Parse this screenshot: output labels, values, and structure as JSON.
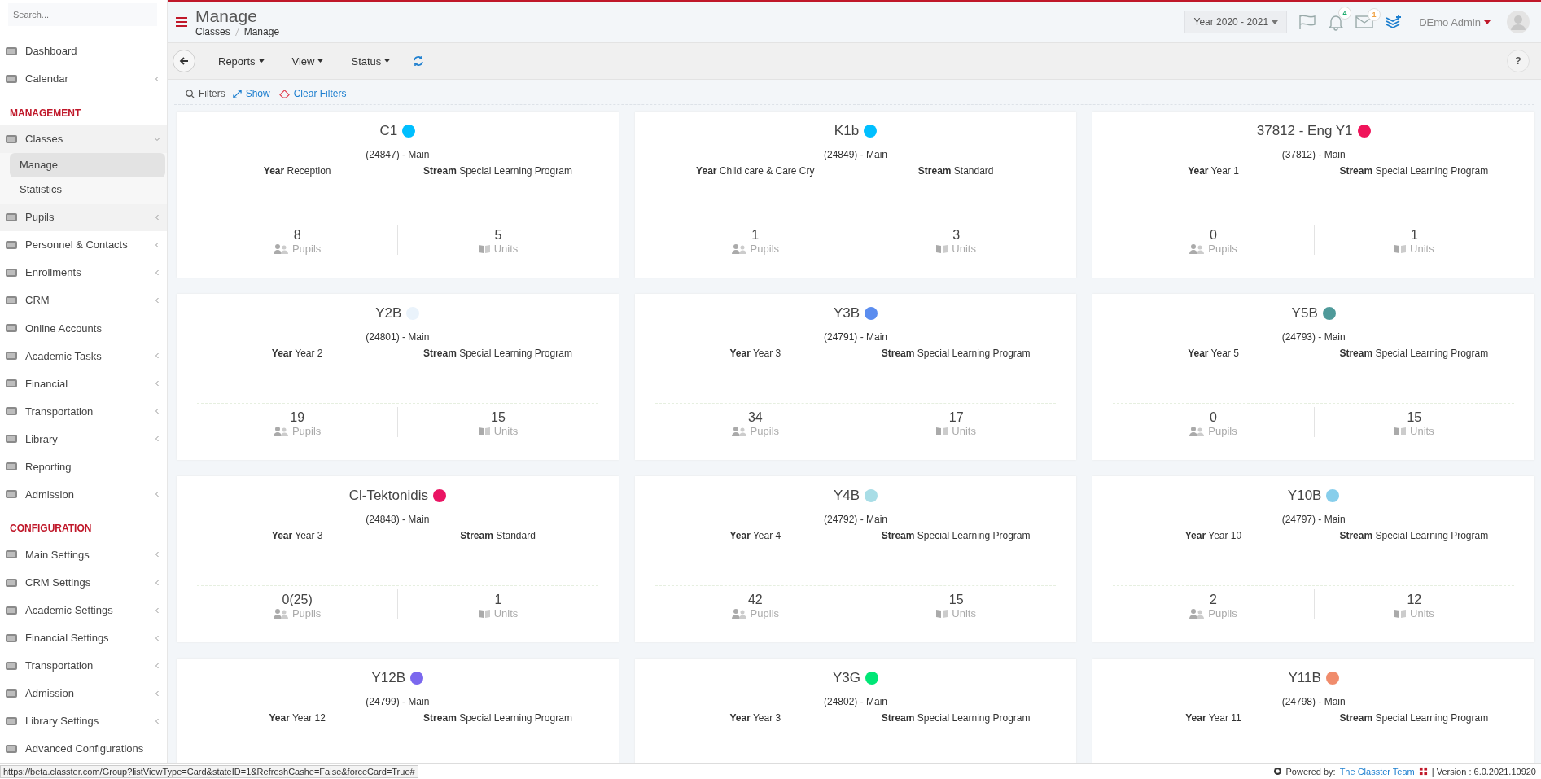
{
  "sidebar": {
    "search": {
      "placeholder": "Search..."
    },
    "sections": [
      {
        "items": [
          {
            "label": "Dashboard",
            "arrow": false,
            "highlighted": false
          },
          {
            "label": "Calendar",
            "arrow": true,
            "highlighted": false
          }
        ]
      },
      {
        "title": "MANAGEMENT",
        "items": [
          {
            "label": "Classes",
            "arrow": true,
            "highlighted": true,
            "expanded": true,
            "children": [
              {
                "label": "Manage",
                "selected": true
              },
              {
                "label": "Statistics",
                "selected": false
              }
            ]
          },
          {
            "label": "Pupils",
            "arrow": true,
            "highlighted": true
          },
          {
            "label": "Personnel & Contacts",
            "arrow": true,
            "highlighted": false
          },
          {
            "label": "Enrollments",
            "arrow": true,
            "highlighted": false
          },
          {
            "label": "CRM",
            "arrow": true,
            "highlighted": false
          },
          {
            "label": "Online Accounts",
            "arrow": false,
            "highlighted": false
          },
          {
            "label": "Academic Tasks",
            "arrow": true,
            "highlighted": false
          },
          {
            "label": "Financial",
            "arrow": true,
            "highlighted": false
          },
          {
            "label": "Transportation",
            "arrow": true,
            "highlighted": false
          },
          {
            "label": "Library",
            "arrow": true,
            "highlighted": false
          },
          {
            "label": "Reporting",
            "arrow": false,
            "highlighted": false
          },
          {
            "label": "Admission",
            "arrow": true,
            "highlighted": false
          }
        ]
      },
      {
        "title": "CONFIGURATION",
        "items": [
          {
            "label": "Main Settings",
            "arrow": true,
            "highlighted": false
          },
          {
            "label": "CRM Settings",
            "arrow": true,
            "highlighted": false
          },
          {
            "label": "Academic Settings",
            "arrow": true,
            "highlighted": false
          },
          {
            "label": "Financial Settings",
            "arrow": true,
            "highlighted": false
          },
          {
            "label": "Transportation",
            "arrow": true,
            "highlighted": false
          },
          {
            "label": "Admission",
            "arrow": true,
            "highlighted": false
          },
          {
            "label": "Library Settings",
            "arrow": true,
            "highlighted": false
          },
          {
            "label": "Advanced Configurations",
            "arrow": false,
            "highlighted": false
          }
        ]
      }
    ]
  },
  "header": {
    "title": "Manage",
    "breadcrumb": [
      "Classes",
      "Manage"
    ],
    "year_select": "Year 2020 - 2021",
    "notifications_badge": "4",
    "messages_badge": "1",
    "user": "DEmo Admin"
  },
  "toolbar": {
    "buttons": [
      "Reports",
      "View",
      "Status"
    ],
    "help": "?"
  },
  "filters": {
    "label": "Filters",
    "show": "Show",
    "clear": "Clear Filters"
  },
  "cards": [
    {
      "name": "C1",
      "color": "#00bfff",
      "code": "(24847) - Main",
      "year": "**Year** Reception",
      "stream": "**Stream** Special Learning Program",
      "pupils": "8",
      "pupils_label": "Pupils",
      "units": "5",
      "units_label": "Units"
    },
    {
      "name": "K1b",
      "color": "#00bfff",
      "code": "(24849) - Main",
      "year": "**Year** Child care & Care Cry",
      "stream": "**Stream** Standard",
      "pupils": "1",
      "pupils_label": "Pupils",
      "units": "3",
      "units_label": "Units"
    },
    {
      "name": "37812 - Eng Y1",
      "color": "#f0145a",
      "code": "(37812) - Main",
      "year": "**Year** Year 1",
      "stream": "**Stream** Special Learning Program",
      "pupils": "0",
      "pupils_label": "Pupils",
      "units": "1",
      "units_label": "Units"
    },
    {
      "name": "Y2B",
      "color": "#eaf3fb",
      "code": "(24801) - Main",
      "year": "**Year** Year 2",
      "stream": "**Stream** Special Learning Program",
      "pupils": "19",
      "pupils_label": "Pupils",
      "units": "15",
      "units_label": "Units"
    },
    {
      "name": "Y3B",
      "color": "#5b8def",
      "code": "(24791) - Main",
      "year": "**Year** Year 3",
      "stream": "**Stream** Special Learning Program",
      "pupils": "34",
      "pupils_label": "Pupils",
      "units": "17",
      "units_label": "Units"
    },
    {
      "name": "Y5B",
      "color": "#4f9a9a",
      "code": "(24793) - Main",
      "year": "**Year** Year 5",
      "stream": "**Stream** Special Learning Program",
      "pupils": "0",
      "pupils_label": "Pupils",
      "units": "15",
      "units_label": "Units"
    },
    {
      "name": "Cl-Tektonidis",
      "color": "#ea1463",
      "code": "(24848) - Main",
      "year": "**Year** Year 3",
      "stream": "**Stream** Standard",
      "pupils": "0(25)",
      "pupils_label": "Pupils",
      "units": "1",
      "units_label": "Units"
    },
    {
      "name": "Y4B",
      "color": "#a8dde6",
      "code": "(24792) - Main",
      "year": "**Year** Year 4",
      "stream": "**Stream** Special Learning Program",
      "pupils": "42",
      "pupils_label": "Pupils",
      "units": "15",
      "units_label": "Units"
    },
    {
      "name": "Y10B",
      "color": "#87ceeb",
      "code": "(24797) - Main",
      "year": "**Year** Year 10",
      "stream": "**Stream** Special Learning Program",
      "pupils": "2",
      "pupils_label": "Pupils",
      "units": "12",
      "units_label": "Units"
    },
    {
      "name": "Y12B",
      "color": "#7b68ee",
      "code": "(24799) - Main",
      "year": "**Year** Year 12",
      "stream": "**Stream** Special Learning Program"
    },
    {
      "name": "Y3G",
      "color": "#00e676",
      "code": "(24802) - Main",
      "year": "**Year** Year 3",
      "stream": "**Stream** Special Learning Program"
    },
    {
      "name": "Y11B",
      "color": "#f08c6c",
      "code": "(24798) - Main",
      "year": "**Year** Year 11",
      "stream": "**Stream** Special Learning Program"
    }
  ],
  "status_bar": {
    "url": "https://beta.classter.com/Group?listViewType=Card&stateID=1&RefreshCashe=False&forceCard=True#",
    "powered_by": "Powered by:",
    "team": "The Classter Team",
    "version": "| Version : 6.0.2021.10920"
  }
}
